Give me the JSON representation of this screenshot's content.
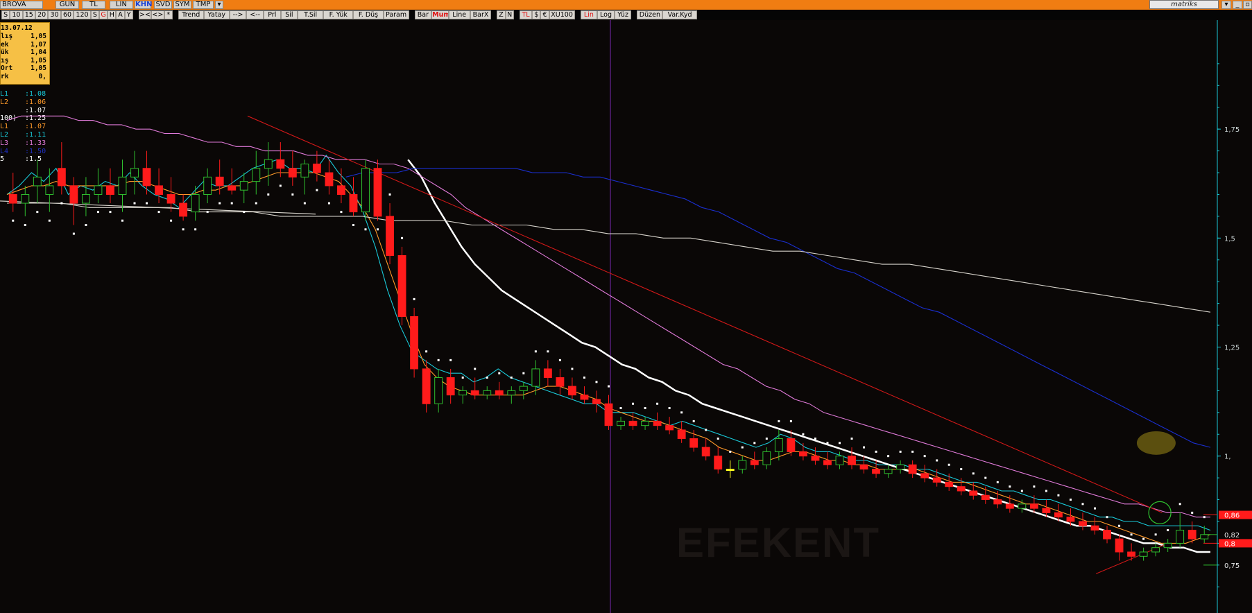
{
  "topbar": {
    "symbol": "BROVA",
    "period": "GUN",
    "currency": "TL",
    "scale": "LIN",
    "khn": "KHN",
    "svd": "SVD",
    "sym": "SYM",
    "tmp": "TMP",
    "brand": "matriks"
  },
  "toolbar": {
    "groups": [
      [
        "S",
        "10",
        "15",
        "20",
        "30",
        "60",
        "120",
        "S",
        "G",
        "H",
        "A",
        "Y"
      ],
      [
        "><",
        "<>",
        "*"
      ],
      [
        "Trend",
        "Yatay",
        "-->",
        "<--",
        "Prl",
        "Sil",
        "T.Sil",
        "F. Yük",
        "F. Düş",
        "Param"
      ],
      [
        "Bar",
        "Mum",
        "Line",
        "BarX"
      ],
      [
        "Z",
        "N"
      ],
      [
        "TL",
        "$",
        "€",
        "XU100"
      ],
      [
        "Lin",
        "Log",
        "Yüz"
      ],
      [
        "Düzen",
        "Var.Kyd"
      ]
    ]
  },
  "colors": {
    "background": "#0a0706",
    "up_candle": "#2fbf2f",
    "down_candle": "#ff1b1b",
    "doji_candle": "#ffff20",
    "axis": "#19c9d8",
    "trendline": "#d01818",
    "cursor": "#7a2ab0"
  },
  "infobox": {
    "date": "13.07.12",
    "rows": [
      {
        "k": "lış",
        "v": "1,05"
      },
      {
        "k": "ek",
        "v": "1,07"
      },
      {
        "k": "ük",
        "v": "1,04"
      },
      {
        "k": "ış",
        "v": "1,05"
      },
      {
        "k": "Ort",
        "v": "1,05"
      },
      {
        "k": "rk",
        "v": "0,"
      }
    ]
  },
  "indicators": [
    {
      "label": "L1",
      "value": ":1.08",
      "color": "#19c9d8"
    },
    {
      "label": "L2",
      "value": ":1.06",
      "color": "#ff9a2a"
    },
    {
      "label": "",
      "value": ":1.07",
      "color": "#ffffff"
    },
    {
      "label": "100)",
      "value": ":1.25",
      "color": "#ffffff"
    },
    {
      "label": "L1",
      "value": ":1.07",
      "color": "#ff9a2a"
    },
    {
      "label": "L2",
      "value": ":1.11",
      "color": "#19c9d8"
    },
    {
      "label": "L3",
      "value": ":1.33",
      "color": "#e07ad8"
    },
    {
      "label": "L4",
      "value": ":1.50",
      "color": "#2030c8"
    },
    {
      "label": "5",
      "value": ":1.5",
      "color": "#ffffff"
    }
  ],
  "watermark": "EFEKENT",
  "chart_data": {
    "type": "candlestick",
    "y_axis": {
      "position": "right",
      "ticks": [
        "1,75",
        "1,5",
        "1,25",
        "1,"
      ],
      "tick_values": [
        1.75,
        1.5,
        1.25,
        1.0
      ],
      "ylim": [
        0.64,
        2.0
      ]
    },
    "price_tags": [
      {
        "label": "0,86",
        "value": 0.865,
        "style": "red"
      },
      {
        "label": "0,82",
        "value": 0.82,
        "style": "plain"
      },
      {
        "label": "0,8",
        "value": 0.8,
        "style": "red"
      },
      {
        "label": "0,75",
        "value": 0.75,
        "style": "plain"
      }
    ],
    "candles": [
      [
        1.6,
        1.65,
        1.56,
        1.58
      ],
      [
        1.58,
        1.62,
        1.55,
        1.6
      ],
      [
        1.62,
        1.68,
        1.58,
        1.64
      ],
      [
        1.6,
        1.66,
        1.56,
        1.62
      ],
      [
        1.66,
        1.72,
        1.6,
        1.62
      ],
      [
        1.62,
        1.64,
        1.53,
        1.58
      ],
      [
        1.58,
        1.64,
        1.55,
        1.6
      ],
      [
        1.6,
        1.66,
        1.58,
        1.62
      ],
      [
        1.62,
        1.66,
        1.58,
        1.6
      ],
      [
        1.6,
        1.68,
        1.56,
        1.64
      ],
      [
        1.64,
        1.7,
        1.6,
        1.66
      ],
      [
        1.66,
        1.7,
        1.6,
        1.62
      ],
      [
        1.62,
        1.66,
        1.58,
        1.6
      ],
      [
        1.6,
        1.64,
        1.56,
        1.58
      ],
      [
        1.58,
        1.6,
        1.54,
        1.55
      ],
      [
        1.56,
        1.62,
        1.54,
        1.6
      ],
      [
        1.6,
        1.66,
        1.58,
        1.64
      ],
      [
        1.64,
        1.68,
        1.6,
        1.62
      ],
      [
        1.62,
        1.66,
        1.6,
        1.61
      ],
      [
        1.61,
        1.65,
        1.58,
        1.63
      ],
      [
        1.63,
        1.7,
        1.6,
        1.66
      ],
      [
        1.66,
        1.72,
        1.62,
        1.68
      ],
      [
        1.68,
        1.72,
        1.64,
        1.66
      ],
      [
        1.66,
        1.7,
        1.62,
        1.64
      ],
      [
        1.64,
        1.68,
        1.6,
        1.67
      ],
      [
        1.67,
        1.7,
        1.63,
        1.65
      ],
      [
        1.65,
        1.68,
        1.6,
        1.62
      ],
      [
        1.62,
        1.66,
        1.58,
        1.6
      ],
      [
        1.6,
        1.64,
        1.55,
        1.56
      ],
      [
        1.56,
        1.68,
        1.54,
        1.66
      ],
      [
        1.66,
        1.68,
        1.54,
        1.55
      ],
      [
        1.55,
        1.58,
        1.44,
        1.46
      ],
      [
        1.46,
        1.48,
        1.3,
        1.32
      ],
      [
        1.32,
        1.34,
        1.18,
        1.2
      ],
      [
        1.2,
        1.22,
        1.1,
        1.12
      ],
      [
        1.12,
        1.2,
        1.1,
        1.18
      ],
      [
        1.18,
        1.2,
        1.12,
        1.14
      ],
      [
        1.14,
        1.16,
        1.12,
        1.15
      ],
      [
        1.15,
        1.18,
        1.13,
        1.14
      ],
      [
        1.14,
        1.16,
        1.13,
        1.15
      ],
      [
        1.15,
        1.17,
        1.13,
        1.14
      ],
      [
        1.14,
        1.16,
        1.12,
        1.15
      ],
      [
        1.15,
        1.17,
        1.13,
        1.16
      ],
      [
        1.16,
        1.22,
        1.14,
        1.2
      ],
      [
        1.2,
        1.22,
        1.16,
        1.18
      ],
      [
        1.18,
        1.2,
        1.14,
        1.16
      ],
      [
        1.16,
        1.18,
        1.13,
        1.14
      ],
      [
        1.14,
        1.16,
        1.12,
        1.13
      ],
      [
        1.13,
        1.15,
        1.1,
        1.12
      ],
      [
        1.12,
        1.14,
        1.06,
        1.07
      ],
      [
        1.07,
        1.09,
        1.06,
        1.08
      ],
      [
        1.08,
        1.1,
        1.06,
        1.07
      ],
      [
        1.07,
        1.09,
        1.06,
        1.08
      ],
      [
        1.08,
        1.1,
        1.06,
        1.07
      ],
      [
        1.07,
        1.09,
        1.05,
        1.06
      ],
      [
        1.06,
        1.08,
        1.03,
        1.04
      ],
      [
        1.04,
        1.06,
        1.01,
        1.02
      ],
      [
        1.02,
        1.04,
        0.99,
        1.0
      ],
      [
        1.0,
        1.02,
        0.96,
        0.97
      ],
      [
        0.97,
        0.99,
        0.95,
        0.97
      ],
      [
        0.97,
        1.0,
        0.96,
        0.99
      ],
      [
        0.99,
        1.01,
        0.97,
        0.98
      ],
      [
        0.98,
        1.02,
        0.97,
        1.01
      ],
      [
        1.01,
        1.06,
        0.99,
        1.04
      ],
      [
        1.04,
        1.06,
        1.0,
        1.01
      ],
      [
        1.01,
        1.03,
        0.99,
        1.0
      ],
      [
        1.0,
        1.02,
        0.98,
        0.99
      ],
      [
        0.99,
        1.01,
        0.97,
        0.98
      ],
      [
        0.98,
        1.01,
        0.97,
        1.0
      ],
      [
        1.0,
        1.02,
        0.97,
        0.98
      ],
      [
        0.98,
        1.0,
        0.96,
        0.97
      ],
      [
        0.97,
        0.99,
        0.95,
        0.96
      ],
      [
        0.96,
        0.98,
        0.95,
        0.97
      ],
      [
        0.97,
        0.99,
        0.96,
        0.98
      ],
      [
        0.98,
        0.99,
        0.95,
        0.96
      ],
      [
        0.96,
        0.98,
        0.94,
        0.95
      ],
      [
        0.95,
        0.97,
        0.93,
        0.94
      ],
      [
        0.94,
        0.96,
        0.92,
        0.93
      ],
      [
        0.93,
        0.95,
        0.91,
        0.92
      ],
      [
        0.92,
        0.94,
        0.9,
        0.91
      ],
      [
        0.91,
        0.93,
        0.89,
        0.9
      ],
      [
        0.9,
        0.92,
        0.88,
        0.89
      ],
      [
        0.89,
        0.91,
        0.87,
        0.88
      ],
      [
        0.88,
        0.9,
        0.87,
        0.89
      ],
      [
        0.89,
        0.91,
        0.87,
        0.88
      ],
      [
        0.88,
        0.9,
        0.86,
        0.87
      ],
      [
        0.87,
        0.89,
        0.85,
        0.86
      ],
      [
        0.86,
        0.88,
        0.84,
        0.85
      ],
      [
        0.85,
        0.87,
        0.83,
        0.84
      ],
      [
        0.84,
        0.86,
        0.82,
        0.83
      ],
      [
        0.83,
        0.84,
        0.8,
        0.81
      ],
      [
        0.81,
        0.82,
        0.76,
        0.78
      ],
      [
        0.78,
        0.8,
        0.76,
        0.77
      ],
      [
        0.77,
        0.79,
        0.76,
        0.78
      ],
      [
        0.78,
        0.8,
        0.77,
        0.79
      ],
      [
        0.79,
        0.81,
        0.78,
        0.8
      ],
      [
        0.8,
        0.87,
        0.79,
        0.83
      ],
      [
        0.83,
        0.85,
        0.8,
        0.81
      ],
      [
        0.81,
        0.84,
        0.8,
        0.82
      ]
    ],
    "series": [
      {
        "color": "#19c9d8",
        "values": [
          1.6,
          1.62,
          1.65,
          1.63,
          1.66,
          1.6,
          1.62,
          1.61,
          1.63,
          1.62,
          1.65,
          1.62,
          1.6,
          1.59,
          1.57,
          1.6,
          1.63,
          1.62,
          1.62,
          1.64,
          1.66,
          1.67,
          1.68,
          1.66,
          1.66,
          1.65,
          1.69,
          1.65,
          1.62,
          1.56,
          1.48,
          1.38,
          1.3,
          1.24,
          1.22,
          1.2,
          1.19,
          1.19,
          1.17,
          1.18,
          1.2,
          1.18,
          1.17,
          1.16,
          1.15,
          1.14,
          1.13,
          1.12,
          1.12,
          1.1,
          1.1,
          1.1,
          1.09,
          1.08,
          1.07,
          1.08,
          1.07,
          1.06,
          1.05,
          1.04,
          1.03,
          1.02,
          1.03,
          1.05,
          1.04,
          1.02,
          1.01,
          1.01,
          1.0,
          0.99,
          0.99,
          0.98,
          0.98,
          0.98,
          0.97,
          0.97,
          0.96,
          0.95,
          0.94,
          0.94,
          0.93,
          0.92,
          0.92,
          0.91,
          0.9,
          0.9,
          0.89,
          0.88,
          0.87,
          0.86,
          0.86,
          0.85,
          0.85,
          0.84,
          0.84,
          0.84,
          0.84,
          0.84,
          0.83
        ]
      },
      {
        "color": "#ff9a2a",
        "values": [
          1.6,
          1.61,
          1.62,
          1.62,
          1.63,
          1.62,
          1.62,
          1.62,
          1.62,
          1.62,
          1.63,
          1.63,
          1.62,
          1.61,
          1.6,
          1.6,
          1.61,
          1.61,
          1.62,
          1.62,
          1.63,
          1.64,
          1.65,
          1.65,
          1.65,
          1.65,
          1.64,
          1.63,
          1.6,
          1.57,
          1.52,
          1.44,
          1.36,
          1.28,
          1.21,
          1.18,
          1.16,
          1.15,
          1.14,
          1.14,
          1.14,
          1.14,
          1.14,
          1.15,
          1.16,
          1.16,
          1.15,
          1.14,
          1.13,
          1.11,
          1.1,
          1.09,
          1.08,
          1.08,
          1.07,
          1.06,
          1.05,
          1.04,
          1.02,
          1.01,
          1.0,
          0.99,
          0.99,
          1.0,
          1.01,
          1.01,
          1.0,
          0.99,
          0.99,
          0.98,
          0.98,
          0.97,
          0.97,
          0.97,
          0.97,
          0.96,
          0.95,
          0.94,
          0.94,
          0.93,
          0.92,
          0.91,
          0.9,
          0.89,
          0.89,
          0.88,
          0.87,
          0.86,
          0.85,
          0.85,
          0.84,
          0.83,
          0.82,
          0.81,
          0.8,
          0.8,
          0.8,
          0.81,
          0.82
        ]
      },
      {
        "color": "#ffffff",
        "width": 2.5,
        "values": [
          null,
          null,
          null,
          null,
          null,
          null,
          null,
          null,
          null,
          null,
          null,
          null,
          null,
          null,
          null,
          null,
          null,
          null,
          null,
          null,
          null,
          null,
          null,
          null,
          null,
          null,
          null,
          null,
          null,
          null,
          1.68,
          1.64,
          1.58,
          1.53,
          1.48,
          1.44,
          1.41,
          1.38,
          1.36,
          1.34,
          1.32,
          1.3,
          1.28,
          1.26,
          1.25,
          1.23,
          1.21,
          1.2,
          1.18,
          1.17,
          1.15,
          1.14,
          1.12,
          1.11,
          1.1,
          1.09,
          1.08,
          1.07,
          1.06,
          1.05,
          1.04,
          1.03,
          1.02,
          1.01,
          1.0,
          0.99,
          0.98,
          0.97,
          0.96,
          0.95,
          0.94,
          0.93,
          0.92,
          0.91,
          0.9,
          0.89,
          0.88,
          0.87,
          0.86,
          0.85,
          0.84,
          0.84,
          0.83,
          0.82,
          0.81,
          0.8,
          0.8,
          0.79,
          0.79,
          0.78,
          0.78
        ]
      },
      {
        "color": "#e07ad8",
        "values": [
          1.77,
          1.78,
          1.78,
          1.78,
          1.78,
          1.77,
          1.77,
          1.76,
          1.76,
          1.75,
          1.75,
          1.74,
          1.74,
          1.73,
          1.72,
          1.72,
          1.71,
          1.71,
          1.7,
          1.7,
          1.7,
          1.69,
          1.69,
          1.68,
          1.68,
          1.68,
          1.67,
          1.67,
          1.66,
          1.64,
          1.62,
          1.6,
          1.57,
          1.55,
          1.53,
          1.51,
          1.49,
          1.47,
          1.45,
          1.43,
          1.41,
          1.39,
          1.37,
          1.35,
          1.33,
          1.31,
          1.29,
          1.27,
          1.25,
          1.23,
          1.21,
          1.2,
          1.18,
          1.16,
          1.15,
          1.13,
          1.12,
          1.1,
          1.09,
          1.08,
          1.07,
          1.06,
          1.05,
          1.04,
          1.03,
          1.02,
          1.01,
          1.0,
          0.99,
          0.98,
          0.97,
          0.96,
          0.95,
          0.94,
          0.93,
          0.92,
          0.91,
          0.9,
          0.89,
          0.89,
          0.88,
          0.87,
          0.87,
          0.86,
          0.86
        ]
      },
      {
        "color": "#1a2fd0",
        "values": [
          null,
          null,
          null,
          null,
          null,
          null,
          null,
          null,
          null,
          null,
          null,
          null,
          null,
          null,
          null,
          null,
          null,
          null,
          null,
          null,
          1.64,
          1.65,
          1.65,
          1.65,
          1.66,
          1.66,
          1.66,
          1.66,
          1.66,
          1.66,
          1.66,
          1.65,
          1.65,
          1.65,
          1.64,
          1.64,
          1.63,
          1.62,
          1.61,
          1.6,
          1.59,
          1.57,
          1.56,
          1.54,
          1.52,
          1.5,
          1.49,
          1.47,
          1.45,
          1.43,
          1.42,
          1.4,
          1.38,
          1.36,
          1.34,
          1.33,
          1.31,
          1.29,
          1.27,
          1.25,
          1.23,
          1.21,
          1.19,
          1.17,
          1.15,
          1.13,
          1.11,
          1.09,
          1.07,
          1.05,
          1.03,
          1.02
        ]
      },
      {
        "color": "#d8d4cc",
        "values": [
          1.58,
          1.58,
          1.58,
          1.57,
          1.57,
          1.57,
          1.57,
          1.56,
          1.56,
          1.56,
          1.55,
          1.55,
          1.55,
          1.55,
          1.54,
          1.54,
          1.54,
          1.53,
          1.53,
          1.53,
          1.52,
          1.52,
          1.51,
          1.51,
          1.5,
          1.5,
          1.49,
          1.48,
          1.47,
          1.47,
          1.46,
          1.45,
          1.44,
          1.44,
          1.43,
          1.42,
          1.41,
          1.4,
          1.39,
          1.38,
          1.37,
          1.36,
          1.35,
          1.34,
          1.33
        ]
      }
    ],
    "trendlines": [
      {
        "from": [
          0.2,
          1.78
        ],
        "to": [
          0.96,
          0.87
        ]
      },
      {
        "from": [
          0.905,
          0.73
        ],
        "to": [
          0.965,
          0.8
        ]
      }
    ],
    "annotations": [
      {
        "shape": "ellipse",
        "at": [
          0.955,
          1.03
        ],
        "color": "#6a5c12"
      },
      {
        "shape": "circle",
        "at": [
          0.958,
          0.87
        ],
        "color": "#2fbf2f"
      }
    ]
  }
}
